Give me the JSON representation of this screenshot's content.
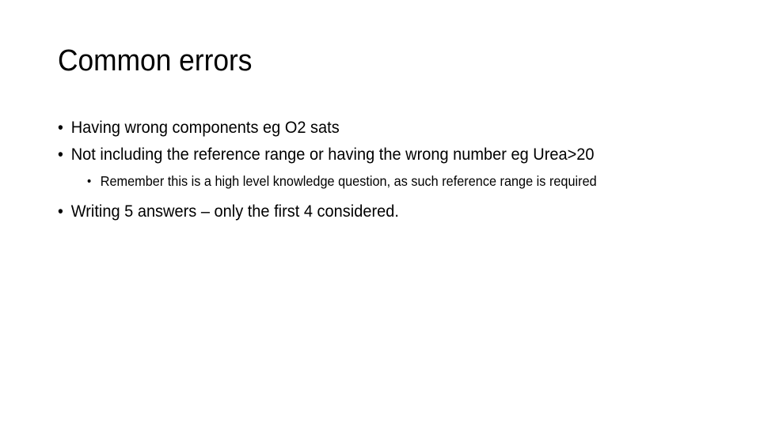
{
  "slide": {
    "title": "Common errors",
    "bullets": [
      {
        "level": 1,
        "text": "Having wrong components eg O2 sats"
      },
      {
        "level": 1,
        "text": "Not including the reference range or having the wrong number eg Urea>20"
      },
      {
        "level": 2,
        "text": "Remember this is a high level knowledge question, as such reference range is required"
      },
      {
        "level": 1,
        "text": "Writing 5 answers – only the first 4 considered."
      }
    ],
    "bullet_char": "•"
  }
}
